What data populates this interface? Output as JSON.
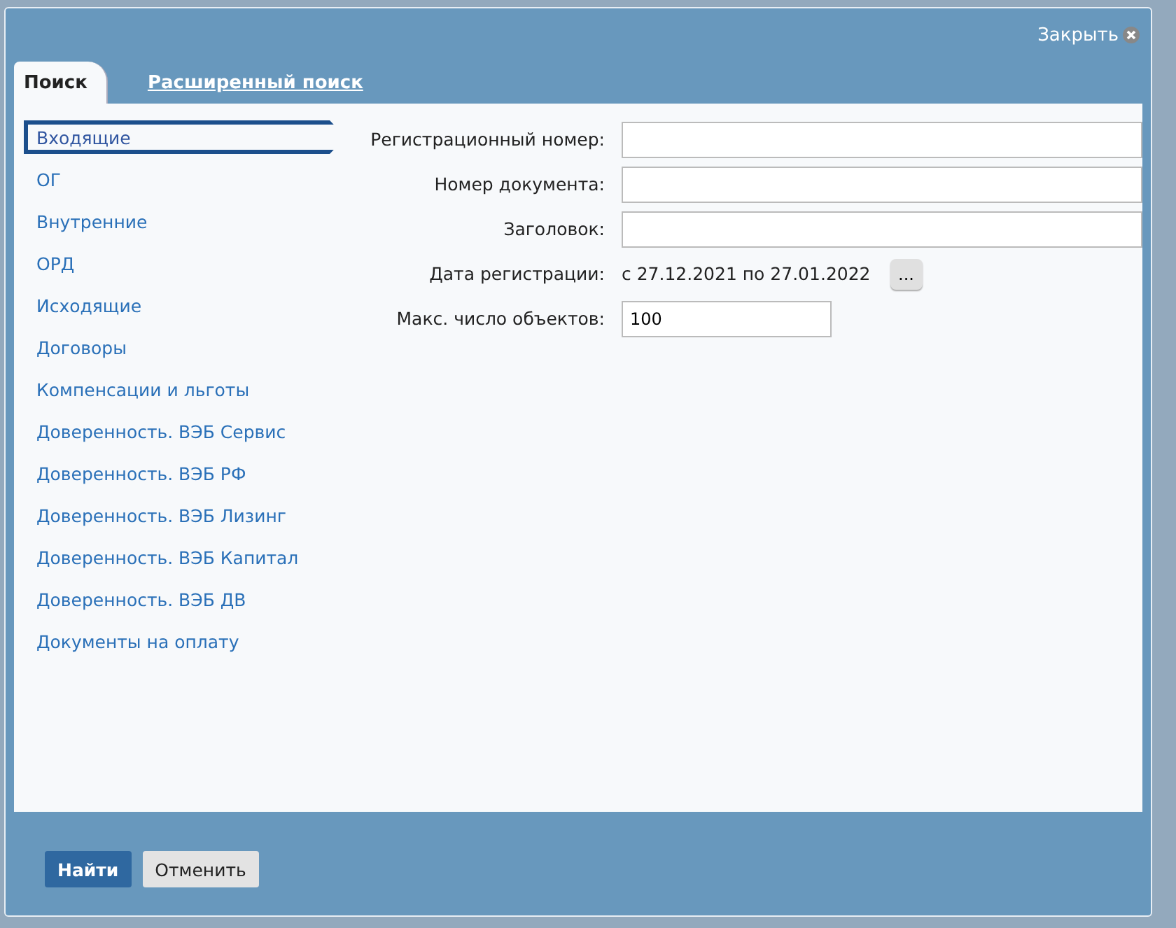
{
  "close": {
    "label": "Закрыть"
  },
  "tabs": [
    {
      "label": "Поиск",
      "selected": true
    },
    {
      "label": "Расширенный поиск",
      "selected": false
    }
  ],
  "categories": [
    {
      "label": "Входящие",
      "selected": true
    },
    {
      "label": "ОГ",
      "selected": false
    },
    {
      "label": "Внутренние",
      "selected": false
    },
    {
      "label": "ОРД",
      "selected": false
    },
    {
      "label": "Исходящие",
      "selected": false
    },
    {
      "label": "Договоры",
      "selected": false
    },
    {
      "label": "Компенсации и льготы",
      "selected": false
    },
    {
      "label": "Доверенность. ВЭБ Сервис",
      "selected": false
    },
    {
      "label": "Доверенность. ВЭБ РФ",
      "selected": false
    },
    {
      "label": "Доверенность. ВЭБ Лизинг",
      "selected": false
    },
    {
      "label": "Доверенность. ВЭБ Капитал",
      "selected": false
    },
    {
      "label": "Доверенность. ВЭБ ДВ",
      "selected": false
    },
    {
      "label": "Документы на оплату",
      "selected": false
    }
  ],
  "fields": [
    {
      "kind": "text",
      "label": "Регистрационный номер:"
    },
    {
      "kind": "text",
      "label": "Номер документа:"
    },
    {
      "kind": "text",
      "label": "Заголовок:"
    },
    {
      "kind": "range",
      "label": "Дата регистрации:",
      "value": "с 27.12.2021 по 27.01.2022",
      "button": "..."
    },
    {
      "kind": "short",
      "label": "Макс. число объектов:",
      "value": "100"
    }
  ],
  "buttons": [
    {
      "label": "Найти",
      "primary": true
    },
    {
      "label": "Отменить",
      "primary": false
    }
  ]
}
